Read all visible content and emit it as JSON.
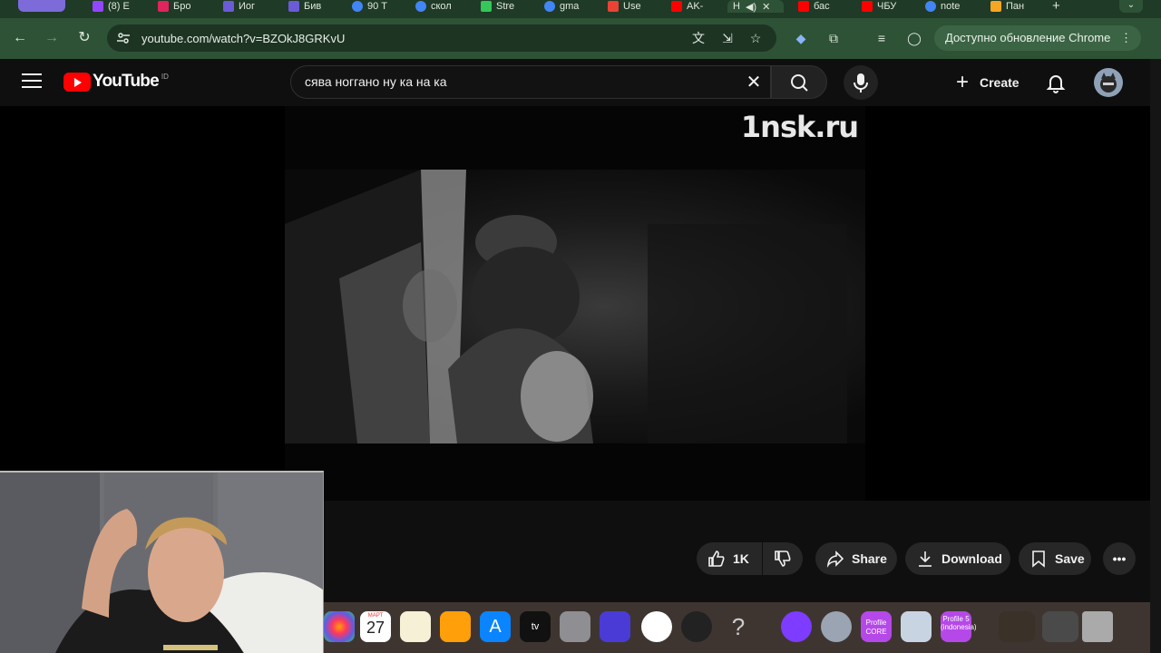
{
  "browser": {
    "tabs": [
      {
        "label": "(8) E",
        "color": "#9146ff"
      },
      {
        "label": "Бро",
        "color": "#e0245e"
      },
      {
        "label": "Иог",
        "color": "#6b5bd6"
      },
      {
        "label": "Бив",
        "color": "#6b5bd6"
      },
      {
        "label": "90 Т",
        "color": "#4285f4"
      },
      {
        "label": "скол",
        "color": "#4285f4"
      },
      {
        "label": "Stre",
        "color": "#34c759"
      },
      {
        "label": "gma",
        "color": "#4285f4"
      },
      {
        "label": "Use",
        "color": "#ea4335"
      },
      {
        "label": "AK-",
        "color": "#ff0000"
      },
      {
        "label": "Н",
        "color": "#ff0000"
      },
      {
        "label": "бас",
        "color": "#ff0000"
      },
      {
        "label": "ЧБУ",
        "color": "#ff0000"
      },
      {
        "label": "note",
        "color": "#4285f4"
      },
      {
        "label": "Пан",
        "color": "#f5a623"
      }
    ],
    "new_tab": "+",
    "url": "youtube.com/watch?v=BZOkJ8GRKvU",
    "update_label": "Доступно обновление Chrome"
  },
  "youtube": {
    "logo_text": "YouTube",
    "country_code": "ID",
    "search_value": "сява ноггано ну ка на ка",
    "create_label": "Create",
    "video_watermark": "1nsk.ru"
  },
  "actions": {
    "like_count": "1K",
    "share_label": "Share",
    "download_label": "Download",
    "save_label": "Save"
  },
  "dock": {
    "calendar_month": "МАРТ",
    "calendar_day": "27",
    "profile_core": "Profile CORE",
    "profile_5": "Profile 5 (indonesia)"
  },
  "colors": {
    "chrome_toolbar": "#2e5236",
    "youtube_red": "#ff0000",
    "page_bg": "#0f0f0f"
  }
}
